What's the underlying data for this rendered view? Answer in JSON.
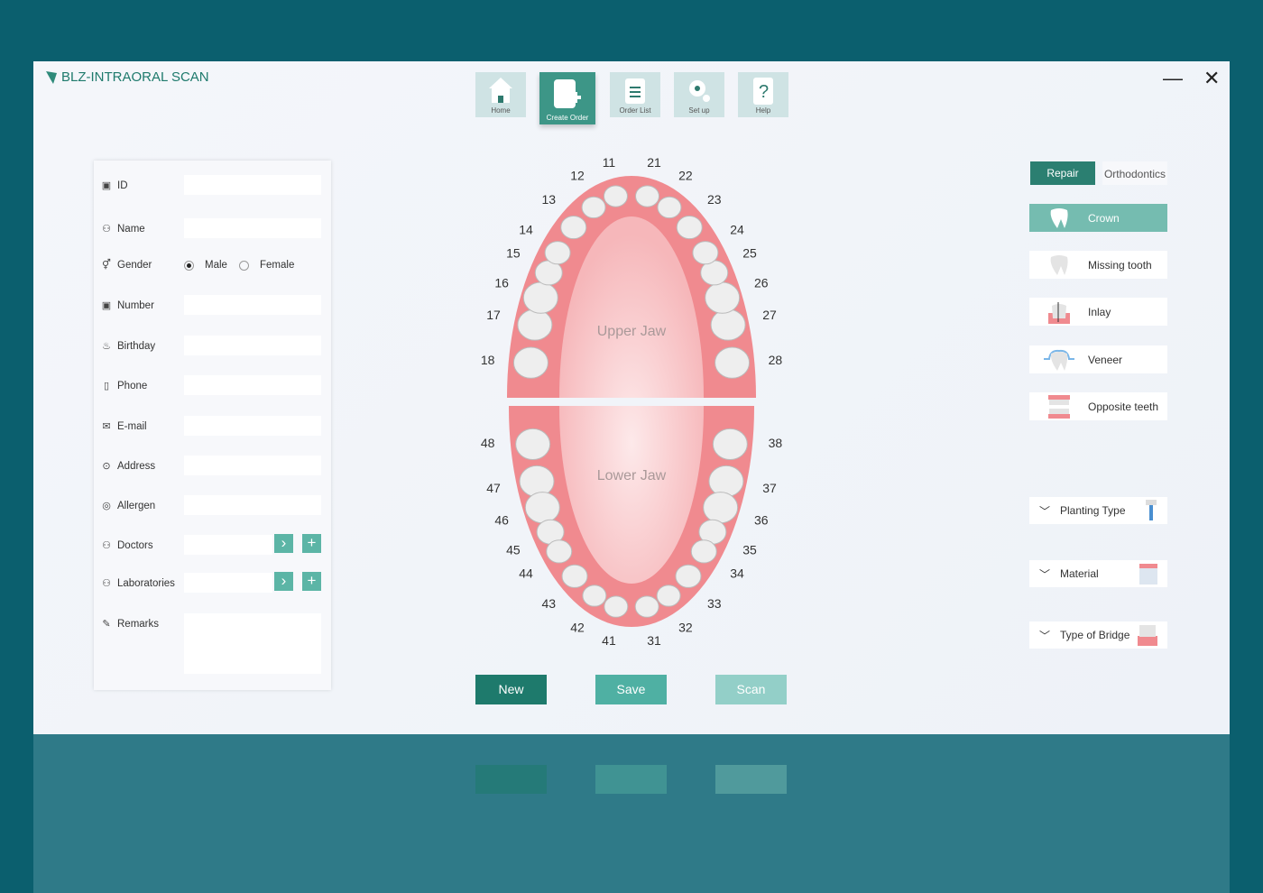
{
  "app": {
    "title": "BLZ-INTRAORAL SCAN",
    "minimize": "—",
    "close": "✕"
  },
  "nav": [
    {
      "label": "Home",
      "icon": "home-icon"
    },
    {
      "label": "Create Order",
      "icon": "create-order-icon",
      "active": true
    },
    {
      "label": "Order List",
      "icon": "order-list-icon"
    },
    {
      "label": "Set up",
      "icon": "settings-icon"
    },
    {
      "label": "Help",
      "icon": "help-icon"
    }
  ],
  "form": {
    "id": {
      "label": "ID",
      "value": ""
    },
    "name": {
      "label": "Name",
      "value": ""
    },
    "gender": {
      "label": "Gender",
      "options": [
        "Male",
        "Female"
      ],
      "selected": "Male"
    },
    "number": {
      "label": "Number",
      "value": ""
    },
    "birthday": {
      "label": "Birthday",
      "value": ""
    },
    "phone": {
      "label": "Phone",
      "value": ""
    },
    "email": {
      "label": "E-mail",
      "value": ""
    },
    "address": {
      "label": "Address",
      "value": ""
    },
    "allergen": {
      "label": "Allergen",
      "value": ""
    },
    "doctors": {
      "label": "Doctors",
      "value": ""
    },
    "laboratories": {
      "label": "Laboratories",
      "value": ""
    },
    "remarks": {
      "label": "Remarks",
      "value": ""
    }
  },
  "chart": {
    "upper_label": "Upper Jaw",
    "lower_label": "Lower Jaw",
    "upper_left": [
      18,
      17,
      16,
      15,
      14,
      13,
      12,
      11
    ],
    "upper_right": [
      28,
      27,
      26,
      25,
      24,
      23,
      22,
      21
    ],
    "lower_left": [
      48,
      47,
      46,
      45,
      44,
      43,
      42,
      41
    ],
    "lower_right": [
      38,
      37,
      36,
      35,
      34,
      33,
      32,
      31
    ],
    "colors": {
      "gum": "#f08a8f",
      "tooth": "#eeeeee"
    }
  },
  "actions": {
    "new": "New",
    "save": "Save",
    "scan": "Scan"
  },
  "modes": {
    "repair": "Repair",
    "orthodontics": "Orthodontics",
    "selected": "Repair"
  },
  "types": [
    {
      "label": "Crown",
      "selected": true
    },
    {
      "label": "Missing tooth"
    },
    {
      "label": "Inlay"
    },
    {
      "label": "Veneer"
    },
    {
      "label": "Opposite teeth"
    }
  ],
  "dropdowns": [
    {
      "label": "Planting Type"
    },
    {
      "label": "Material"
    },
    {
      "label": "Type of Bridge"
    }
  ],
  "colors": {
    "accent": "#2e8a7a",
    "accent_light": "#75bcb0",
    "background": "#0b5f6e"
  }
}
